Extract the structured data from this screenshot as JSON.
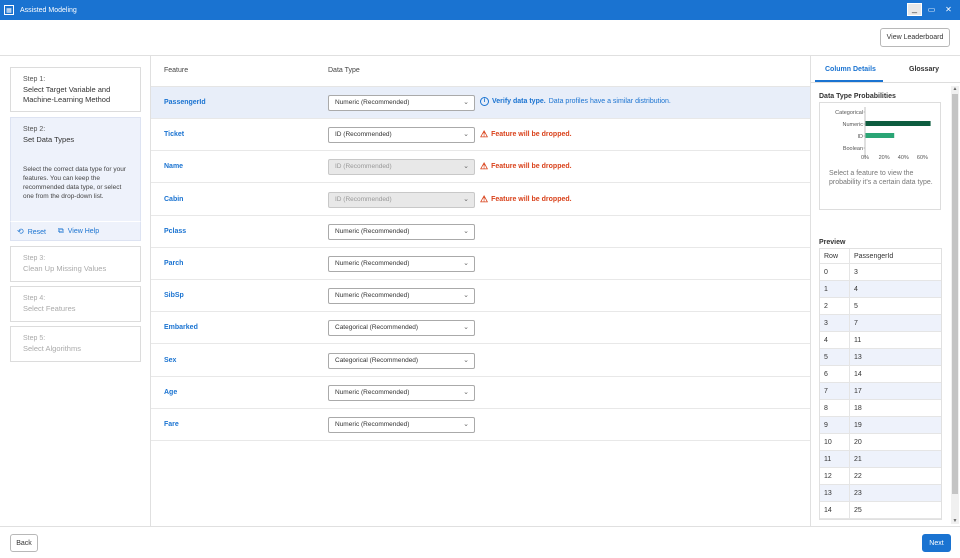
{
  "window": {
    "title": "Assisted Modeling",
    "app_icon": "table-icon",
    "min": "_",
    "max": "▭",
    "close": "✕"
  },
  "toolbar": {
    "leaderboard_label": "View Leaderboard"
  },
  "steps": [
    {
      "num": "Step 1:",
      "name": "Select Target Variable and Machine-Learning Method"
    },
    {
      "num": "Step 2:",
      "name": "Set Data Types",
      "desc": "Select the correct data type for your features. You can keep the recommended data type, or select one from the drop-down list."
    },
    {
      "num": "Step 3:",
      "name": "Clean Up Missing Values"
    },
    {
      "num": "Step 4:",
      "name": "Select Features"
    },
    {
      "num": "Step 5:",
      "name": "Select Algorithms"
    }
  ],
  "step_actions": {
    "reset": "Reset",
    "help": "View Help"
  },
  "table": {
    "col_feature": "Feature",
    "col_type": "Data Type",
    "rows": [
      {
        "feature": "PassengerId",
        "type": "Numeric (Recommended)",
        "disabled": false,
        "note_kind": "info",
        "note_bold": "Verify data type.",
        "note_text": " Data profiles have a similar distribution."
      },
      {
        "feature": "Ticket",
        "type": "ID (Recommended)",
        "disabled": false,
        "note_kind": "warn",
        "note_bold": "Feature will be dropped.",
        "note_text": ""
      },
      {
        "feature": "Name",
        "type": "ID (Recommended)",
        "disabled": true,
        "note_kind": "warn",
        "note_bold": "Feature will be dropped.",
        "note_text": ""
      },
      {
        "feature": "Cabin",
        "type": "ID (Recommended)",
        "disabled": true,
        "note_kind": "warn",
        "note_bold": "Feature will be dropped.",
        "note_text": ""
      },
      {
        "feature": "Pclass",
        "type": "Numeric (Recommended)",
        "disabled": false,
        "note_kind": "",
        "note_bold": "",
        "note_text": ""
      },
      {
        "feature": "Parch",
        "type": "Numeric (Recommended)",
        "disabled": false,
        "note_kind": "",
        "note_bold": "",
        "note_text": ""
      },
      {
        "feature": "SibSp",
        "type": "Numeric (Recommended)",
        "disabled": false,
        "note_kind": "",
        "note_bold": "",
        "note_text": ""
      },
      {
        "feature": "Embarked",
        "type": "Categorical (Recommended)",
        "disabled": false,
        "note_kind": "",
        "note_bold": "",
        "note_text": ""
      },
      {
        "feature": "Sex",
        "type": "Categorical (Recommended)",
        "disabled": false,
        "note_kind": "",
        "note_bold": "",
        "note_text": ""
      },
      {
        "feature": "Age",
        "type": "Numeric (Recommended)",
        "disabled": false,
        "note_kind": "",
        "note_bold": "",
        "note_text": ""
      },
      {
        "feature": "Fare",
        "type": "Numeric (Recommended)",
        "disabled": false,
        "note_kind": "",
        "note_bold": "",
        "note_text": ""
      }
    ]
  },
  "right_panel": {
    "tab1": "Column Details",
    "tab2": "Glossary",
    "dtp_title": "Data Type Probabilities",
    "dtp_help": "Select a feature to view the probability it's a certain data type.",
    "preview_title": "Preview",
    "preview_cols": [
      "Row",
      "PassengerId"
    ],
    "preview_rows": [
      [
        "0",
        "3"
      ],
      [
        "1",
        "4"
      ],
      [
        "2",
        "5"
      ],
      [
        "3",
        "7"
      ],
      [
        "4",
        "11"
      ],
      [
        "5",
        "13"
      ],
      [
        "6",
        "14"
      ],
      [
        "7",
        "17"
      ],
      [
        "8",
        "18"
      ],
      [
        "9",
        "19"
      ],
      [
        "10",
        "20"
      ],
      [
        "11",
        "21"
      ],
      [
        "12",
        "22"
      ],
      [
        "13",
        "23"
      ],
      [
        "14",
        "25"
      ]
    ]
  },
  "chart_data": {
    "type": "bar",
    "orientation": "horizontal",
    "categories": [
      "Categorical",
      "Numeric",
      "ID",
      "Boolean"
    ],
    "values": [
      0,
      0.68,
      0.3,
      0
    ],
    "xticks": [
      "0%",
      "20%",
      "40%",
      "60%"
    ],
    "xlim": [
      0,
      0.7
    ],
    "colors": [
      "#0d5c3f",
      "#0d5c3f",
      "#2aa575",
      "#0d5c3f"
    ],
    "grid": false
  },
  "footer": {
    "back": "Back",
    "next": "Next"
  },
  "colors": {
    "accent": "#1a73d1",
    "warn": "#d9421b"
  }
}
